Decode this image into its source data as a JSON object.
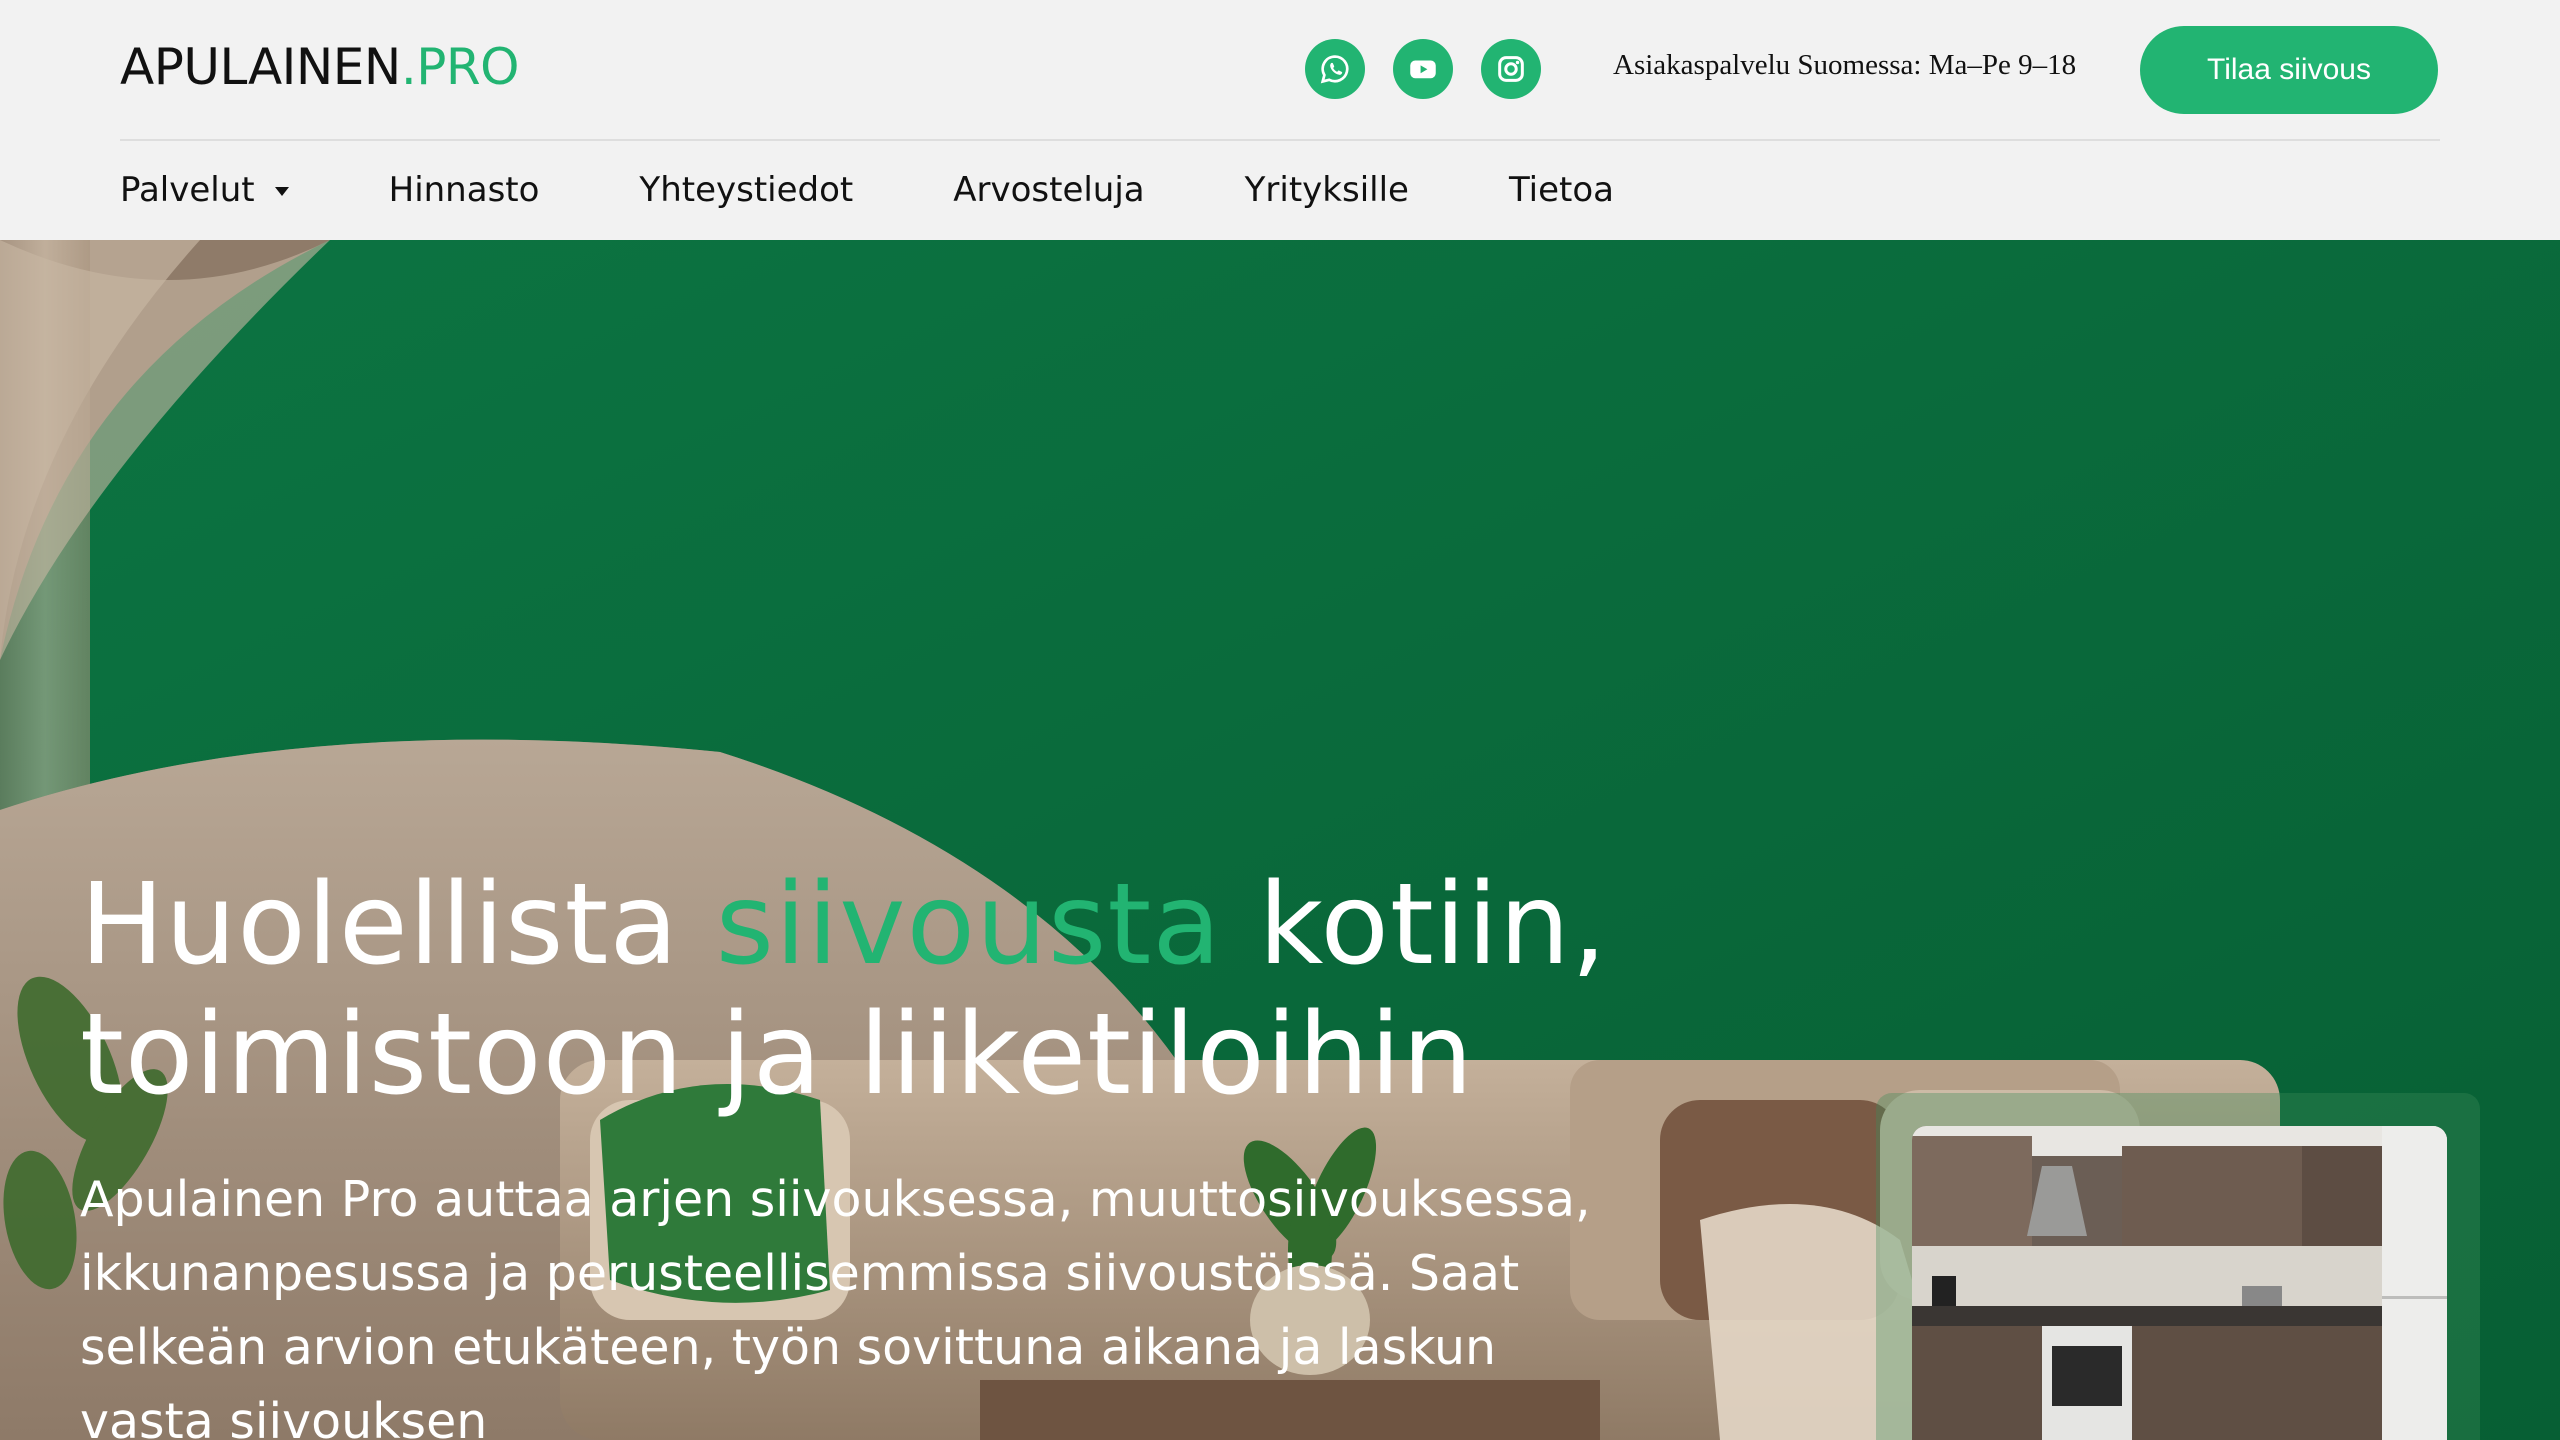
{
  "header": {
    "logo": {
      "main": "APULAINEN",
      "accent": ".PRO"
    },
    "socials": [
      {
        "name": "whatsapp-icon"
      },
      {
        "name": "youtube-icon"
      },
      {
        "name": "instagram-icon"
      }
    ],
    "service_hours": "Asiakaspalvelu Suomessa: Ma–Pe 9–18",
    "cta_label": "Tilaa siivous"
  },
  "nav": {
    "items": [
      {
        "label": "Palvelut",
        "dropdown": true
      },
      {
        "label": "Hinnasto"
      },
      {
        "label": "Yhteystiedot"
      },
      {
        "label": "Arvosteluja"
      },
      {
        "label": "Yrityksille"
      },
      {
        "label": "Tietoa"
      }
    ]
  },
  "hero": {
    "title_part1": "Huolellista ",
    "title_accent": "siivousta",
    "title_part2": " kotiin,",
    "title_line2": "toimistoon ja liiketiloihin",
    "text": "Apulainen Pro auttaa arjen siivouksessa, muuttosiivouksessa, ikkunanpesussa ja perusteellisemmissa siivoustöissä. Saat selkeän arvion etukäteen, työn sovittuna aikana ja laskun vasta siivouksen"
  },
  "colors": {
    "accent": "#22b472",
    "wall_green": "#0b6e3e",
    "header_bg": "#f2f2f2"
  }
}
